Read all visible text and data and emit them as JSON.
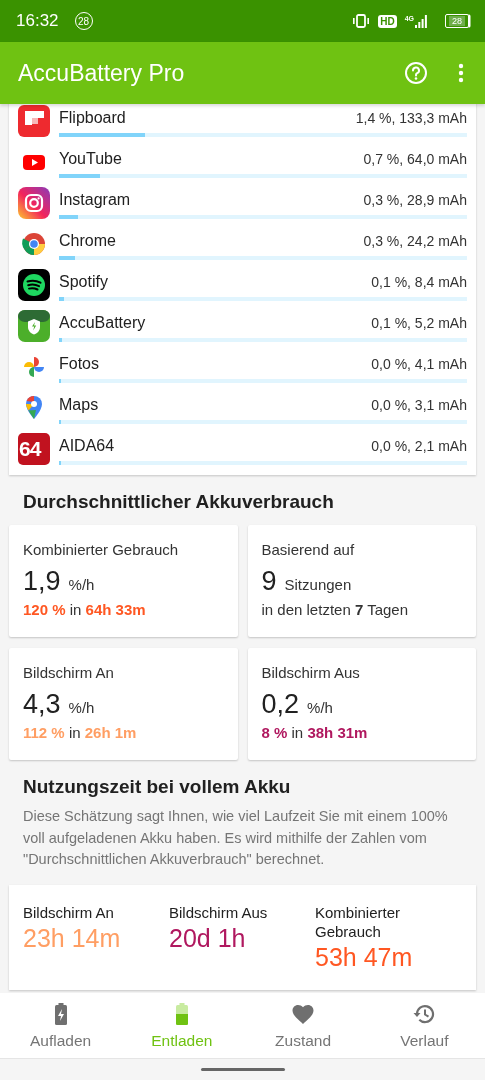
{
  "status_bar": {
    "time": "16:32",
    "notification_badge": "28",
    "network_badge": "HD",
    "network_type": "4G",
    "battery": "28"
  },
  "app_bar": {
    "title": "AccuBattery Pro"
  },
  "apps": [
    {
      "name": "Flipboard",
      "reading": "1,4 %, 133,3 mAh",
      "level": 0.21
    },
    {
      "name": "YouTube",
      "reading": "0,7 %, 64,0 mAh",
      "level": 0.1
    },
    {
      "name": "Instagram",
      "reading": "0,3 %, 28,9 mAh",
      "level": 0.047
    },
    {
      "name": "Chrome",
      "reading": "0,3 %, 24,2 mAh",
      "level": 0.039
    },
    {
      "name": "Spotify",
      "reading": "0,1 %, 8,4 mAh",
      "level": 0.013
    },
    {
      "name": "AccuBattery",
      "reading": "0,1 %, 5,2 mAh",
      "level": 0.007
    },
    {
      "name": "Fotos",
      "reading": "0,0 %, 4,1 mAh",
      "level": 0.005
    },
    {
      "name": "Maps",
      "reading": "0,0 %, 3,1 mAh",
      "level": 0.005
    },
    {
      "name": "AIDA64",
      "reading": "0,0 %, 2,1 mAh",
      "level": 0.004,
      "icon_label": "64"
    }
  ],
  "average": {
    "title": "Durchschnittlicher Akkuverbrauch",
    "cards": [
      {
        "label": "Kombinierter Gebrauch",
        "value": "1,9",
        "unit": "%/h",
        "detail": "**120 %** in **64h 33m**",
        "color": "#ff5722"
      },
      {
        "label": "Basierend auf",
        "value": "9",
        "unit": "Sitzungen",
        "detail": "in den letzten **7** Tagen"
      },
      {
        "label": "Bildschirm An",
        "value": "4,3",
        "unit": "%/h",
        "detail": "**112 %** in **26h 1m**",
        "color": "#ff9e63"
      },
      {
        "label": "Bildschirm Aus",
        "value": "0,2",
        "unit": "%/h",
        "detail": "**8 %** in **38h 31m**",
        "color": "#b0185f"
      }
    ]
  },
  "full_charge": {
    "title": "Nutzungszeit bei vollem Akku",
    "description": "Diese Schätzung sagt Ihnen, wie viel Laufzeit Sie mit einem 100% voll aufgeladenen Akku haben. Es wird mithilfe der Zahlen vom \"Durchschnittlichen Akkuverbrauch\" berechnet.",
    "items": [
      {
        "label": "Bildschirm An",
        "value": "23h 14m",
        "color": "#ff9e63"
      },
      {
        "label": "Bildschirm Aus",
        "value": "20d 1h",
        "color": "#b0185f"
      },
      {
        "label": "Kombinierter Gebrauch",
        "value": "53h 47m",
        "color": "#ff5722"
      }
    ]
  },
  "bottom_nav": [
    {
      "label": "Aufladen",
      "selected": false
    },
    {
      "label": "Entladen",
      "selected": true
    },
    {
      "label": "Zustand",
      "selected": false
    },
    {
      "label": "Verlauf",
      "selected": false
    }
  ]
}
